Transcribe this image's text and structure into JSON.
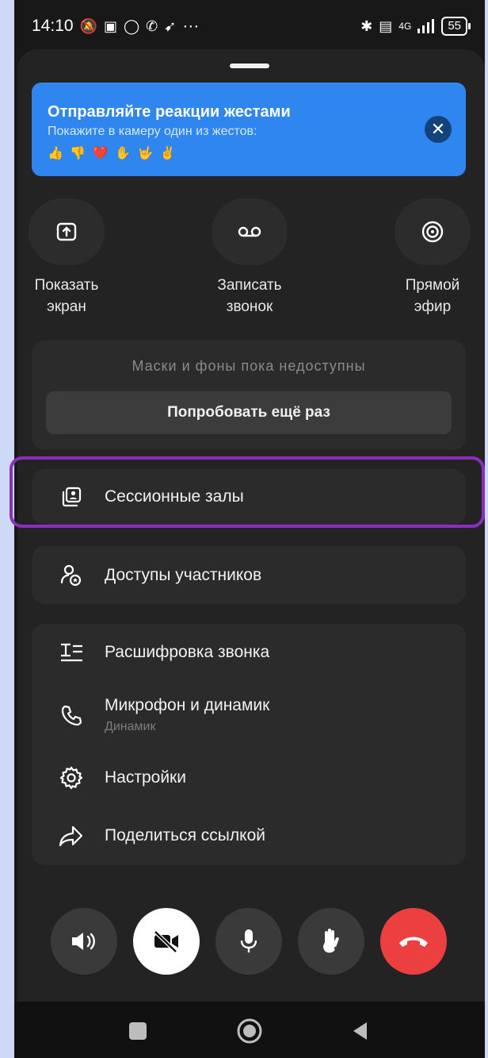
{
  "status_bar": {
    "time": "14:10",
    "more": "···",
    "network": "4G",
    "battery": "55"
  },
  "banner": {
    "title": "Отправляйте реакции жестами",
    "subtitle": "Покажите в камеру один из жестов:",
    "emojis": "👍 👎 ❤️ ✋ 🤟 ✌️",
    "close_icon": "close-icon"
  },
  "actions": [
    {
      "label_line1": "Показать",
      "label_line2": "экран",
      "icon": "share-screen-icon"
    },
    {
      "label_line1": "Записать",
      "label_line2": "звонок",
      "icon": "record-icon"
    },
    {
      "label_line1": "Прямой",
      "label_line2": "эфир",
      "icon": "broadcast-icon"
    }
  ],
  "masks": {
    "text": "Маски и фоны пока недоступны",
    "retry_label": "Попробовать ещё раз"
  },
  "menu": {
    "breakout": {
      "label": "Сессионные залы",
      "icon": "breakout-rooms-icon"
    },
    "permissions": {
      "label": "Доступы участников",
      "icon": "participant-access-icon"
    },
    "transcription": {
      "label": "Расшифровка звонка",
      "icon": "transcription-icon"
    },
    "audio": {
      "label": "Микрофон и динамик",
      "sublabel": "Динамик",
      "icon": "phone-icon"
    },
    "settings": {
      "label": "Настройки",
      "icon": "gear-icon"
    },
    "share": {
      "label": "Поделиться ссылкой",
      "icon": "share-arrow-icon"
    }
  },
  "call_controls": [
    "speaker-icon",
    "camera-off-icon",
    "microphone-icon",
    "raise-hand-icon",
    "end-call-icon"
  ],
  "colors": {
    "accent_blue": "#2f86ee",
    "highlight_purple": "#8a2ebd",
    "end_call_red": "#ec3f3f",
    "sheet_bg": "#232323"
  }
}
